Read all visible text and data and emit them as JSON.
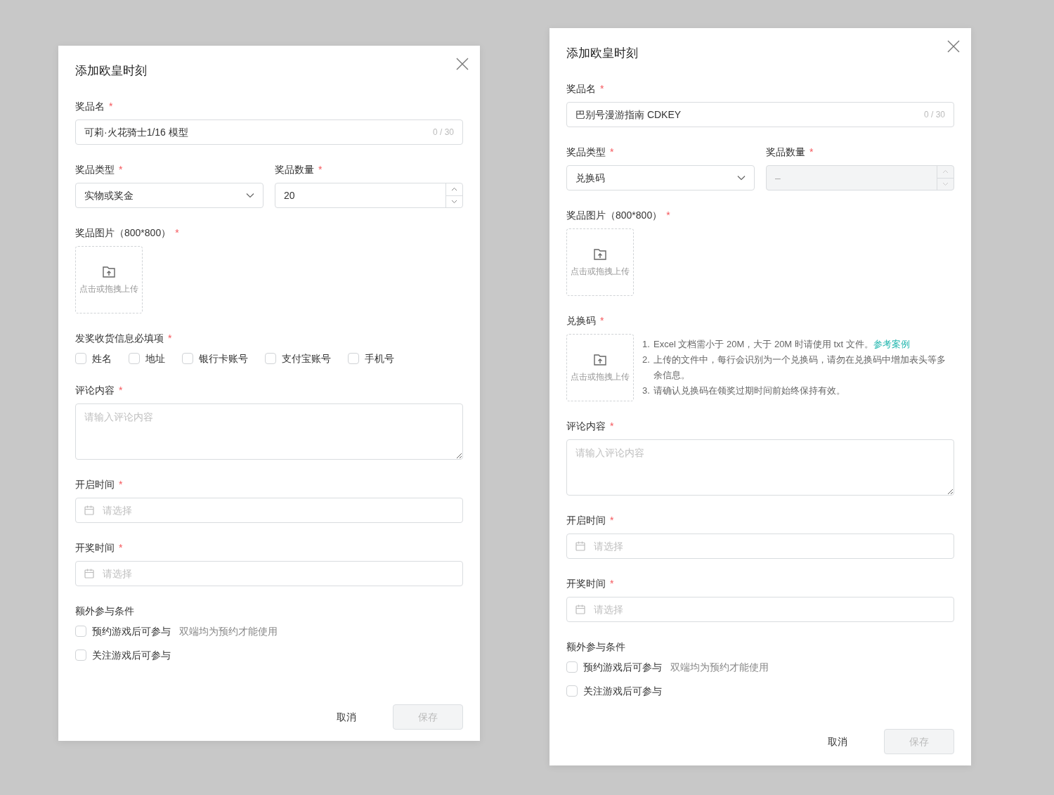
{
  "dialogs": [
    {
      "title": "添加欧皇时刻",
      "fields": [
        {
          "kind": "text",
          "label": "奖品名",
          "required_mark": "*",
          "value": "可莉·火花骑士1/16 模型",
          "counter": "0 / 30"
        },
        {
          "kind": "pair",
          "items": [
            {
              "kind": "select",
              "label": "奖品类型",
              "required_mark": "*",
              "value": "实物或奖金"
            },
            {
              "kind": "number",
              "label": "奖品数量",
              "required_mark": "*",
              "value": "20",
              "disabled": false
            }
          ]
        },
        {
          "kind": "upload",
          "label": "奖品图片（800*800）",
          "required_mark": "*",
          "hint": "点击或拖拽上传"
        },
        {
          "kind": "checkboxes",
          "label": "发奖收货信息必填项",
          "required_mark": "*",
          "options": [
            {
              "label": "姓名",
              "checked": false
            },
            {
              "label": "地址",
              "checked": false
            },
            {
              "label": "银行卡账号",
              "checked": false
            },
            {
              "label": "支付宝账号",
              "checked": false
            },
            {
              "label": "手机号",
              "checked": false
            }
          ]
        },
        {
          "kind": "textarea",
          "label": "评论内容",
          "required_mark": "*",
          "placeholder": "请输入评论内容"
        },
        {
          "kind": "date",
          "label": "开启时间",
          "required_mark": "*",
          "placeholder": "请选择"
        },
        {
          "kind": "date",
          "label": "开奖时间",
          "required_mark": "*",
          "placeholder": "请选择"
        },
        {
          "kind": "conditions",
          "label": "额外参与条件",
          "options": [
            {
              "label": "预约游戏后可参与",
              "note": "双端均为预约才能使用",
              "checked": false
            },
            {
              "label": "关注游戏后可参与",
              "checked": false
            }
          ]
        }
      ],
      "cancel": "取消",
      "save": "保存",
      "save_disabled": true
    },
    {
      "title": "添加欧皇时刻",
      "fields": [
        {
          "kind": "text",
          "label": "奖品名",
          "required_mark": "*",
          "value": "巴别号漫游指南 CDKEY",
          "counter": "0 / 30"
        },
        {
          "kind": "pair",
          "items": [
            {
              "kind": "select",
              "label": "奖品类型",
              "required_mark": "*",
              "value": "兑换码"
            },
            {
              "kind": "number",
              "label": "奖品数量",
              "required_mark": "*",
              "value": "–",
              "disabled": true
            }
          ]
        },
        {
          "kind": "upload",
          "label": "奖品图片（800*800）",
          "required_mark": "*",
          "hint": "点击或拖拽上传"
        },
        {
          "kind": "code_upload",
          "label": "兑换码",
          "required_mark": "*",
          "hint": "点击或拖拽上传",
          "notes": [
            {
              "number": "1.",
              "text": "Excel 文档需小于 20M，大于 20M 时请使用 txt 文件。",
              "link": "参考案例"
            },
            {
              "number": "2.",
              "text": "上传的文件中，每行会识别为一个兑换码，请勿在兑换码中增加表头等多余信息。"
            },
            {
              "number": "3.",
              "text": "请确认兑换码在领奖过期时间前始终保持有效。"
            }
          ]
        },
        {
          "kind": "textarea",
          "label": "评论内容",
          "required_mark": "*",
          "placeholder": "请输入评论内容"
        },
        {
          "kind": "date",
          "label": "开启时间",
          "required_mark": "*",
          "placeholder": "请选择"
        },
        {
          "kind": "date",
          "label": "开奖时间",
          "required_mark": "*",
          "placeholder": "请选择"
        },
        {
          "kind": "conditions",
          "label": "额外参与条件",
          "options": [
            {
              "label": "预约游戏后可参与",
              "note": "双端均为预约才能使用",
              "checked": false
            },
            {
              "label": "关注游戏后可参与",
              "checked": false
            }
          ]
        }
      ],
      "cancel": "取消",
      "save": "保存",
      "save_disabled": true
    }
  ]
}
